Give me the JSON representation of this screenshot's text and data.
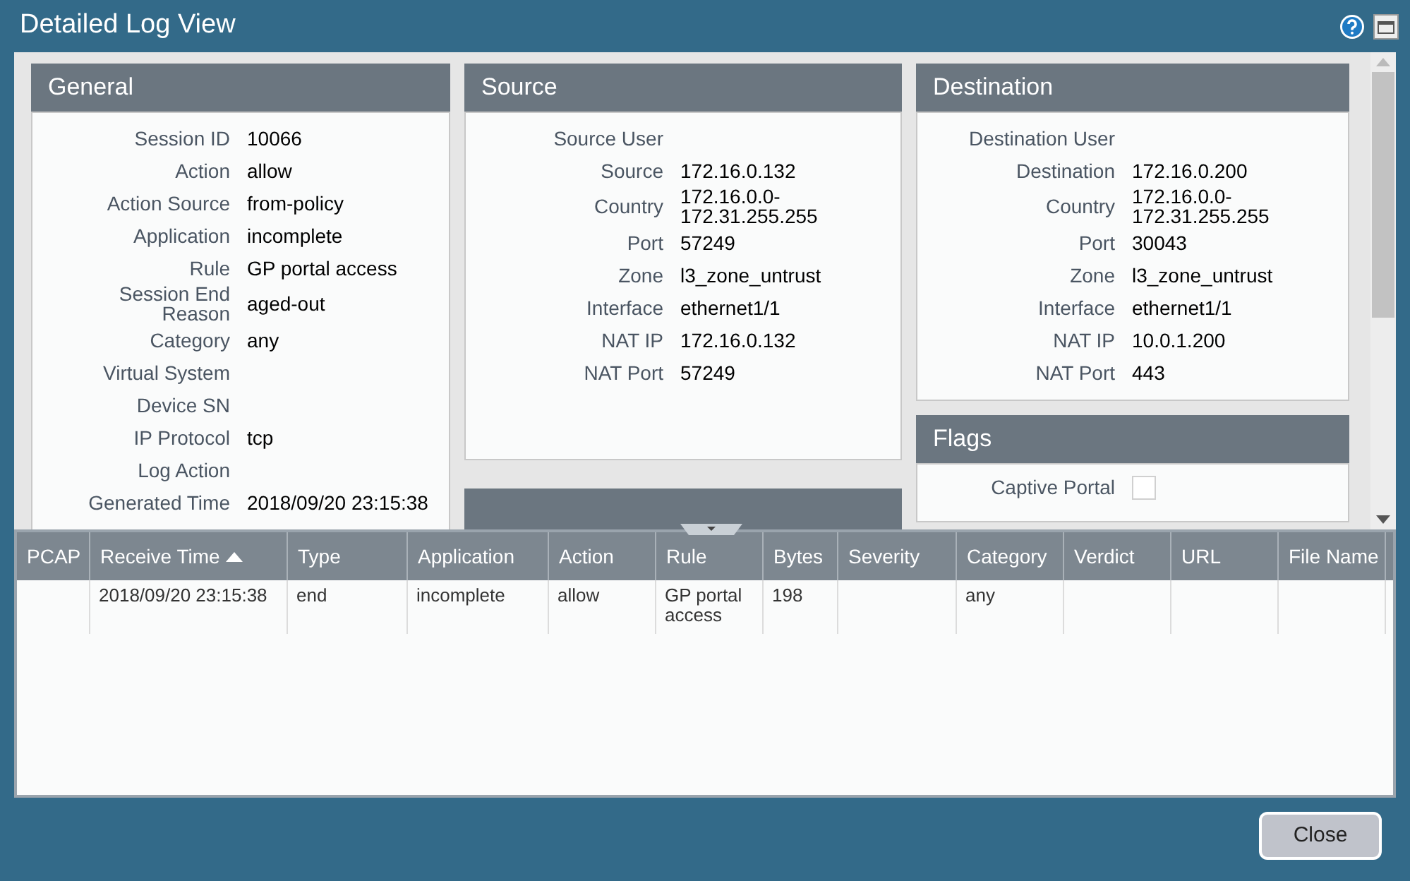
{
  "window": {
    "title": "Detailed Log View"
  },
  "panels": [
    {
      "title": "General",
      "fields": [
        {
          "label": "Session ID",
          "value": "10066"
        },
        {
          "label": "Action",
          "value": "allow"
        },
        {
          "label": "Action Source",
          "value": "from-policy"
        },
        {
          "label": "Application",
          "value": "incomplete"
        },
        {
          "label": "Rule",
          "value": "GP portal access"
        },
        {
          "label": "Session End Reason",
          "value": "aged-out"
        },
        {
          "label": "Category",
          "value": "any"
        },
        {
          "label": "Virtual System"
        },
        {
          "label": "Device SN"
        },
        {
          "label": "IP Protocol",
          "value": "tcp"
        },
        {
          "label": "Log Action"
        },
        {
          "label": "Generated Time",
          "value": "2018/09/20 23:15:38"
        }
      ]
    },
    {
      "title": "Source",
      "fields": [
        {
          "label": "Source User"
        },
        {
          "label": "Source",
          "value": "172.16.0.132"
        },
        {
          "label": "Country",
          "value": "172.16.0.0-172.31.255.255"
        },
        {
          "label": "Port",
          "value": "57249"
        },
        {
          "label": "Zone",
          "value": "l3_zone_untrust"
        },
        {
          "label": "Interface",
          "value": "ethernet1/1"
        },
        {
          "label": "NAT IP",
          "value": "172.16.0.132"
        },
        {
          "label": "NAT Port",
          "value": "57249"
        }
      ]
    },
    {
      "title": "Destination",
      "fields": [
        {
          "label": "Destination User"
        },
        {
          "label": "Destination",
          "value": "172.16.0.200"
        },
        {
          "label": "Country",
          "value": "172.16.0.0-172.31.255.255"
        },
        {
          "label": "Port",
          "value": "30043"
        },
        {
          "label": "Zone",
          "value": "l3_zone_untrust"
        },
        {
          "label": "Interface",
          "value": "ethernet1/1"
        },
        {
          "label": "NAT IP",
          "value": "10.0.1.200"
        },
        {
          "label": "NAT Port",
          "value": "443"
        }
      ]
    }
  ],
  "flags": {
    "title": "Flags",
    "items": [
      {
        "label": "Captive Portal",
        "checked": false
      }
    ]
  },
  "table": {
    "columns": [
      {
        "label": "PCAP"
      },
      {
        "label": "Receive Time",
        "sorted_ascending": true
      },
      {
        "label": "Type"
      },
      {
        "label": "Application"
      },
      {
        "label": "Action"
      },
      {
        "label": "Rule"
      },
      {
        "label": "Bytes"
      },
      {
        "label": "Severity"
      },
      {
        "label": "Category"
      },
      {
        "label": "Verdict"
      },
      {
        "label": "URL"
      },
      {
        "label": "File Name"
      }
    ],
    "rows": [
      {
        "cells": [
          "",
          "2018/09/20 23:15:38",
          "end",
          "incomplete",
          "allow",
          "GP portal access",
          "198",
          "",
          "any",
          "",
          "",
          ""
        ]
      }
    ]
  },
  "buttons": [
    {
      "label": "Close"
    }
  ]
}
